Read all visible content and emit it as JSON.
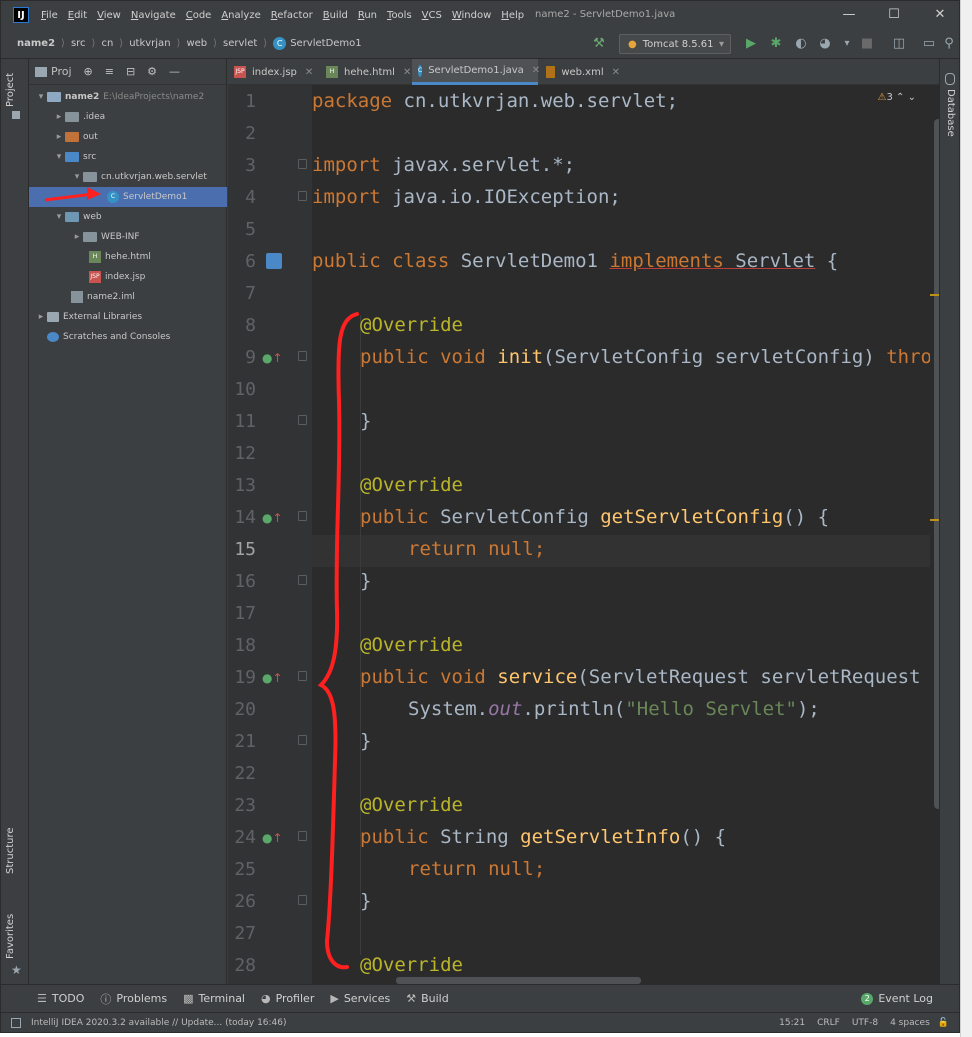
{
  "app": {
    "title": "name2 - ServletDemo1.java",
    "menu": [
      "File",
      "Edit",
      "View",
      "Navigate",
      "Code",
      "Analyze",
      "Refactor",
      "Build",
      "Run",
      "Tools",
      "VCS",
      "Window",
      "Help"
    ]
  },
  "breadcrumb": [
    "name2",
    "src",
    "cn",
    "utkvrjan",
    "web",
    "servlet",
    "ServletDemo1"
  ],
  "run_config": "Tomcat 8.5.61",
  "left_tabs": {
    "project": "Project",
    "structure": "Structure",
    "favorites": "Favorites"
  },
  "right_tabs": {
    "database": "Database"
  },
  "project_panel": {
    "header": "Proj",
    "tree": [
      {
        "label": "name2",
        "hint": "E:\\IdeaProjects\\name2",
        "icon": "module-folder-icon"
      },
      {
        "label": ".idea",
        "icon": "folder-icon"
      },
      {
        "label": "out",
        "icon": "folder-orange-icon"
      },
      {
        "label": "src",
        "icon": "source-folder-icon"
      },
      {
        "label": "cn.utkvrjan.web.servlet",
        "icon": "package-icon"
      },
      {
        "label": "ServletDemo1",
        "icon": "java-class-icon"
      },
      {
        "label": "web",
        "icon": "web-folder-icon"
      },
      {
        "label": "WEB-INF",
        "icon": "folder-icon"
      },
      {
        "label": "hehe.html",
        "icon": "html-file-icon"
      },
      {
        "label": "index.jsp",
        "icon": "jsp-file-icon"
      },
      {
        "label": "name2.iml",
        "icon": "iml-file-icon"
      },
      {
        "label": "External Libraries",
        "icon": "library-icon"
      },
      {
        "label": "Scratches and Consoles",
        "icon": "scratch-icon"
      }
    ]
  },
  "tabs": [
    "index.jsp",
    "hehe.html",
    "ServletDemo1.java",
    "web.xml"
  ],
  "inspection": {
    "warnings": "3"
  },
  "editor": {
    "current_line": "15",
    "line_numbers": [
      "1",
      "2",
      "3",
      "4",
      "5",
      "6",
      "7",
      "8",
      "9",
      "10",
      "11",
      "12",
      "13",
      "14",
      "15",
      "16",
      "17",
      "18",
      "19",
      "20",
      "21",
      "22",
      "23",
      "24",
      "25",
      "26",
      "27",
      "28"
    ],
    "code": {
      "l1_kw": "package",
      "l1_rest": " cn.utkvrjan.web.servlet;",
      "l3_kw": "import",
      "l3_rest": " javax.servlet.*;",
      "l4_kw": "import",
      "l4_rest": " java.io.IOException;",
      "l6_kw": "public class",
      "l6_name": " ServletDemo1 ",
      "l6_impl": "implements",
      "l6_sp": " ",
      "l6_iface": "Servlet",
      "l6_brace": " {",
      "override": "@Override",
      "l9_kw": "public void ",
      "l9_m": "init",
      "l9_args": "(ServletConfig servletConfig) ",
      "l9_thr": "throws",
      "close": "}",
      "l14_kw": "public ",
      "l14_t": "ServletConfig ",
      "l14_m": "getServletConfig",
      "l14_end": "() {",
      "ret_kw": "return null",
      "ret_end": ";",
      "l19_kw": "public void ",
      "l19_m": "service",
      "l19_args": "(ServletRequest servletRequest",
      "l20_a": "System.",
      "l20_f": "out",
      "l20_b": ".println(",
      "l20_s": "\"Hello Servlet\"",
      "l20_c": ");",
      "l24_kw": "public ",
      "l24_t": "String ",
      "l24_m": "getServletInfo",
      "l24_end": "() {"
    }
  },
  "bottom_tools": [
    "TODO",
    "Problems",
    "Terminal",
    "Profiler",
    "Services",
    "Build"
  ],
  "event_log": {
    "count": "2",
    "label": "Event Log"
  },
  "status": {
    "message": "IntelliJ IDEA 2020.3.2 available // Update... (today 16:46)",
    "position": "15:21",
    "line_sep": "CRLF",
    "encoding": "UTF-8",
    "indent": "4 spaces"
  },
  "colors": {
    "accent": "#4a88c7",
    "annotation_red": "#ff2020",
    "selection": "#4b6eaf",
    "background": "#2b2b2b"
  }
}
